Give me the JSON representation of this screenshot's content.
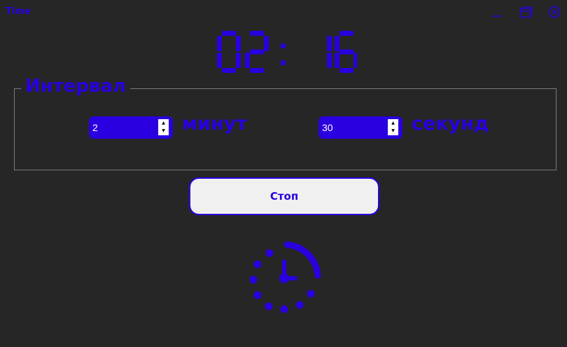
{
  "window": {
    "title": "Time",
    "controls": [
      "minimize-icon",
      "maximize-icon",
      "close-icon"
    ],
    "accent_color": "#2a00e0",
    "background_color": "#262626"
  },
  "timer": {
    "minutes": "02",
    "separator": ":",
    "seconds": "16"
  },
  "interval": {
    "legend": "Интервал",
    "minutes_value": "2",
    "minutes_label": "минут",
    "seconds_value": "30",
    "seconds_label": "секунд"
  },
  "actions": {
    "stop_label": "Стоп"
  },
  "status_icon": "clock-loading-icon"
}
